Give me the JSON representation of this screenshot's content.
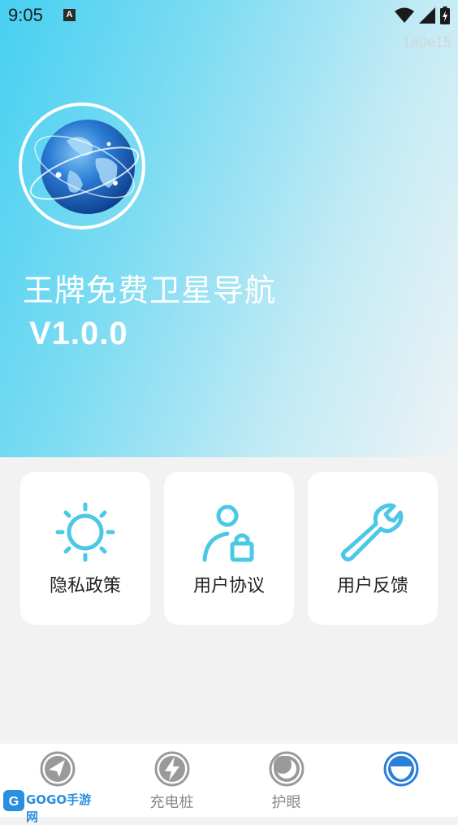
{
  "status_bar": {
    "time": "9:05",
    "notification_badge": "A",
    "icons": [
      "wifi-icon",
      "signal-icon",
      "battery-icon"
    ]
  },
  "watermark": "1a0e15",
  "app": {
    "title": "王牌免费卫星导航",
    "version": "V1.0.0",
    "logo_icon": "globe-icon"
  },
  "cards": [
    {
      "label": "隐私政策",
      "icon": "sun-icon"
    },
    {
      "label": "用户协议",
      "icon": "user-lock-icon"
    },
    {
      "label": "用户反馈",
      "icon": "wrench-icon"
    }
  ],
  "tabs": [
    {
      "label": "",
      "icon": "navigation-icon"
    },
    {
      "label": "充电桩",
      "icon": "charging-icon"
    },
    {
      "label": "护眼",
      "icon": "moon-icon"
    },
    {
      "label": "",
      "icon": "bowl-icon",
      "active": true
    }
  ],
  "site_logo": {
    "text": "GOGO手游网"
  },
  "colors": {
    "accent": "#4cc8e6",
    "active_tab": "#2a7fd8",
    "hero_start": "#46d0f1",
    "hero_end": "#eef3f5"
  }
}
